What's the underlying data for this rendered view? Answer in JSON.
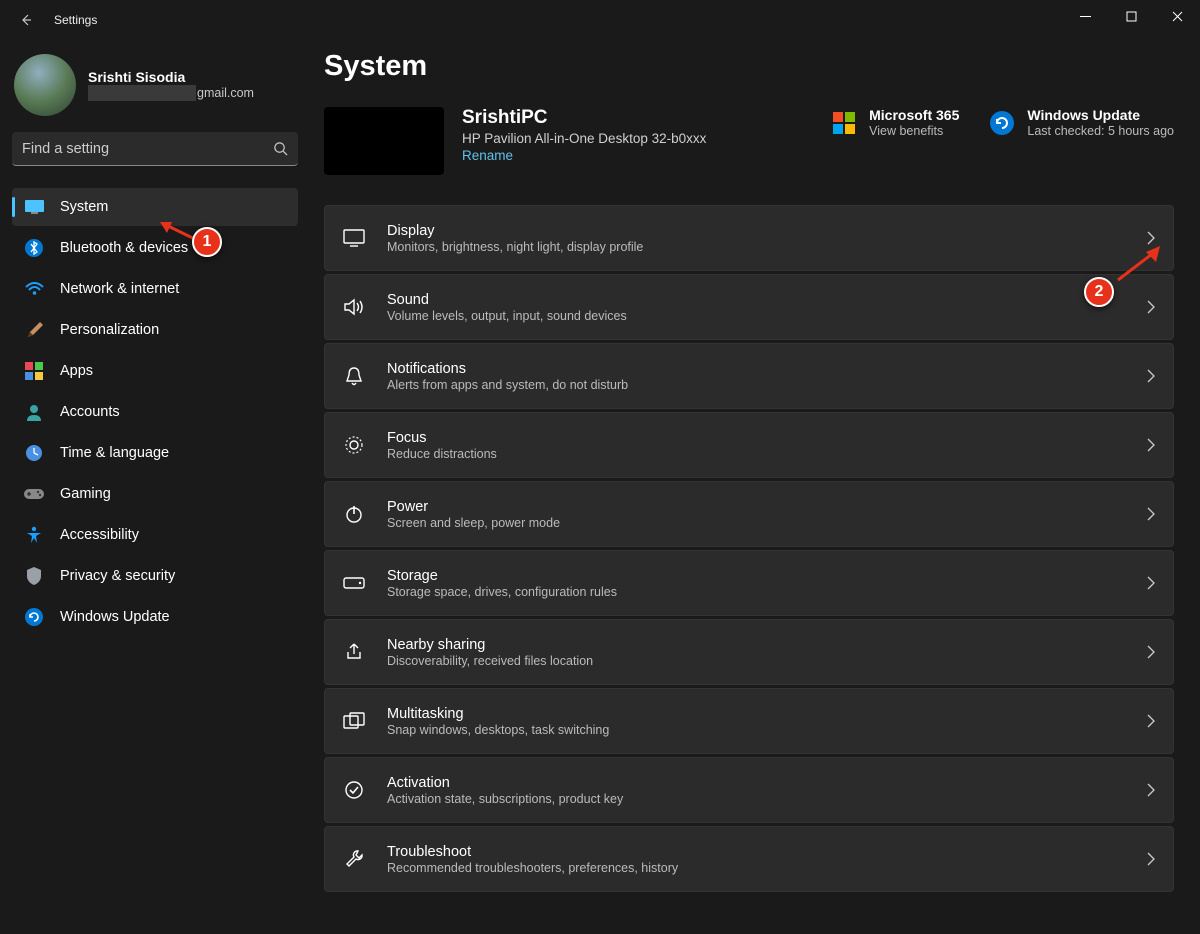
{
  "window": {
    "title": "Settings"
  },
  "user": {
    "name": "Srishti Sisodia",
    "email_suffix": "gmail.com"
  },
  "search": {
    "placeholder": "Find a setting"
  },
  "nav": [
    {
      "label": "System",
      "selected": true
    },
    {
      "label": "Bluetooth & devices"
    },
    {
      "label": "Network & internet"
    },
    {
      "label": "Personalization"
    },
    {
      "label": "Apps"
    },
    {
      "label": "Accounts"
    },
    {
      "label": "Time & language"
    },
    {
      "label": "Gaming"
    },
    {
      "label": "Accessibility"
    },
    {
      "label": "Privacy & security"
    },
    {
      "label": "Windows Update"
    }
  ],
  "page": {
    "title": "System"
  },
  "pc": {
    "name": "SrishtiPC",
    "model": "HP Pavilion All-in-One Desktop 32-b0xxx",
    "rename": "Rename"
  },
  "widgets": {
    "m365": {
      "title": "Microsoft 365",
      "sub": "View benefits"
    },
    "update": {
      "title": "Windows Update",
      "sub": "Last checked: 5 hours ago"
    }
  },
  "panels": [
    {
      "title": "Display",
      "sub": "Monitors, brightness, night light, display profile"
    },
    {
      "title": "Sound",
      "sub": "Volume levels, output, input, sound devices"
    },
    {
      "title": "Notifications",
      "sub": "Alerts from apps and system, do not disturb"
    },
    {
      "title": "Focus",
      "sub": "Reduce distractions"
    },
    {
      "title": "Power",
      "sub": "Screen and sleep, power mode"
    },
    {
      "title": "Storage",
      "sub": "Storage space, drives, configuration rules"
    },
    {
      "title": "Nearby sharing",
      "sub": "Discoverability, received files location"
    },
    {
      "title": "Multitasking",
      "sub": "Snap windows, desktops, task switching"
    },
    {
      "title": "Activation",
      "sub": "Activation state, subscriptions, product key"
    },
    {
      "title": "Troubleshoot",
      "sub": "Recommended troubleshooters, preferences, history"
    }
  ],
  "annotations": {
    "marker1": "1",
    "marker2": "2"
  }
}
